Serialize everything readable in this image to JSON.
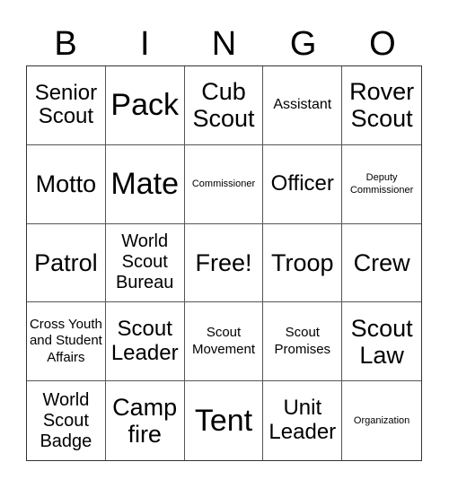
{
  "header": {
    "letters": [
      "B",
      "I",
      "N",
      "G",
      "O"
    ]
  },
  "cells": [
    {
      "text": "Senior Scout",
      "size": "s-m"
    },
    {
      "text": "Pack",
      "size": "s-xl"
    },
    {
      "text": "Cub Scout",
      "size": "s-l"
    },
    {
      "text": "Assistant",
      "size": "s-s"
    },
    {
      "text": "Rover Scout",
      "size": "s-l"
    },
    {
      "text": "Motto",
      "size": "s-l"
    },
    {
      "text": "Mate",
      "size": "s-xl"
    },
    {
      "text": "Commissioner",
      "size": "s-xxs"
    },
    {
      "text": "Officer",
      "size": "s-m"
    },
    {
      "text": "Deputy Commissioner",
      "size": "s-xxs"
    },
    {
      "text": "Patrol",
      "size": "s-l"
    },
    {
      "text": "World Scout Bureau",
      "size": "s-ms"
    },
    {
      "text": "Free!",
      "size": "s-l"
    },
    {
      "text": "Troop",
      "size": "s-l"
    },
    {
      "text": "Crew",
      "size": "s-l"
    },
    {
      "text": "Cross Youth and Student Affairs",
      "size": "s-xs"
    },
    {
      "text": "Scout Leader",
      "size": "s-m"
    },
    {
      "text": "Scout Movement",
      "size": "s-xs"
    },
    {
      "text": "Scout Promises",
      "size": "s-xs"
    },
    {
      "text": "Scout Law",
      "size": "s-l"
    },
    {
      "text": "World Scout Badge",
      "size": "s-ms"
    },
    {
      "text": "Camp fire",
      "size": "s-l"
    },
    {
      "text": "Tent",
      "size": "s-xl"
    },
    {
      "text": "Unit Leader",
      "size": "s-m"
    },
    {
      "text": "Organization",
      "size": "s-xxs"
    }
  ]
}
